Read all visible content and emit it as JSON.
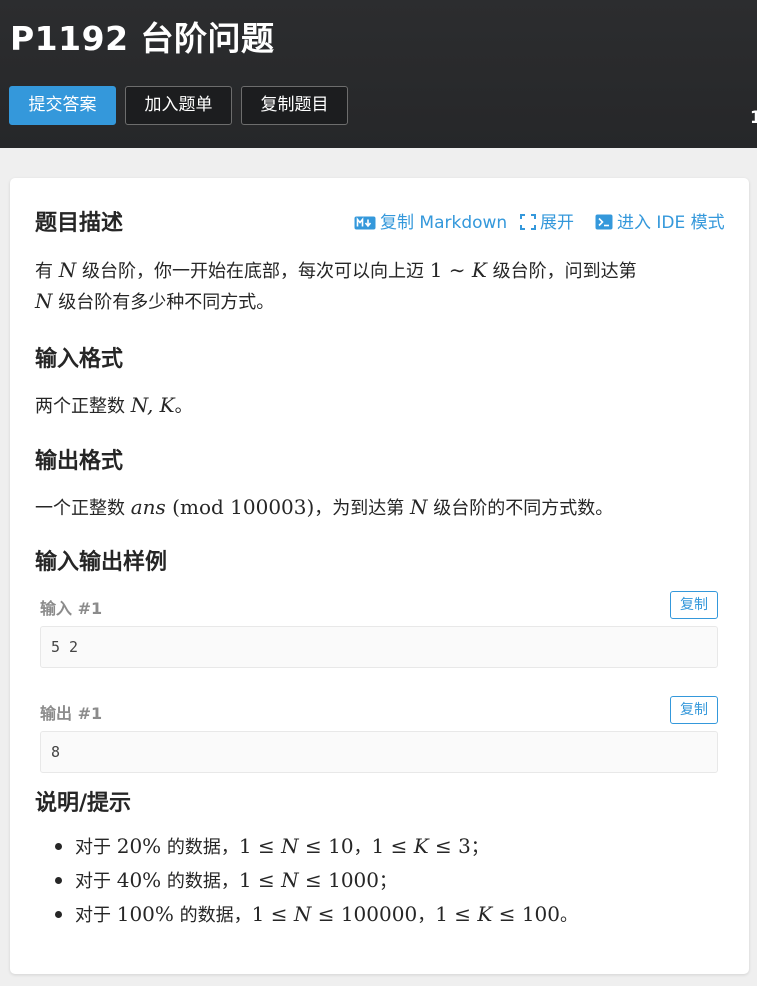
{
  "header": {
    "title": "P1192 台阶问题",
    "submit_label": "提交答案",
    "add_list_label": "加入题单",
    "copy_problem_label": "复制题目",
    "edge_number": "1"
  },
  "toolbar": {
    "copy_markdown": "复制 Markdown",
    "expand": "展开",
    "ide_mode": "进入 IDE 模式"
  },
  "description": {
    "heading": "题目描述",
    "l1_a": "有 ",
    "l1_N": "N",
    "l1_b": " 级台阶，你一开始在底部，每次可以向上迈 ",
    "l1_1": "1",
    "l1_tilde": " ∼ ",
    "l1_K": "K",
    "l1_c": " 级台阶，问到达第",
    "l2_N": "N",
    "l2_a": " 级台阶有多少种不同方式。"
  },
  "input_format": {
    "heading": "输入格式",
    "text_a": "两个正整数 ",
    "math": "N, K",
    "text_b": "。"
  },
  "output_format": {
    "heading": "输出格式",
    "text_a": "一个正整数 ",
    "ans": "ans",
    "mod": " (mod 100003)",
    "text_b": "，为到达第 ",
    "N": "N",
    "text_c": " 级台阶的不同方式数。"
  },
  "samples": {
    "heading": "输入输出样例",
    "input_label": "输入 #1",
    "output_label": "输出 #1",
    "copy_label": "复制",
    "input_value": "5 2",
    "output_value": "8"
  },
  "hints": {
    "heading": "说明/提示",
    "items": [
      {
        "a": "对于 ",
        "pct": "20%",
        "b": " 的数据，",
        "c1": "1 ≤ ",
        "v1": "N",
        "c2": " ≤ 10",
        "sep": "，",
        "c3": "1 ≤ ",
        "v2": "K",
        "c4": " ≤ 3",
        "end": "；"
      },
      {
        "a": "对于 ",
        "pct": "40%",
        "b": " 的数据，",
        "c1": "1 ≤ ",
        "v1": "N",
        "c2": " ≤ 1000",
        "end": "；"
      },
      {
        "a": "对于 ",
        "pct": "100%",
        "b": " 的数据，",
        "c1": "1 ≤ ",
        "v1": "N",
        "c2": " ≤ 100000",
        "sep": "，",
        "c3": "1 ≤ ",
        "v2": "K",
        "c4": " ≤ 100",
        "end": "。"
      }
    ]
  },
  "colors": {
    "accent": "#3498db",
    "header_bg": "#2c2d2f",
    "page_bg": "#efefef"
  },
  "icons": [
    "markdown-icon",
    "expand-icon",
    "terminal-icon"
  ]
}
